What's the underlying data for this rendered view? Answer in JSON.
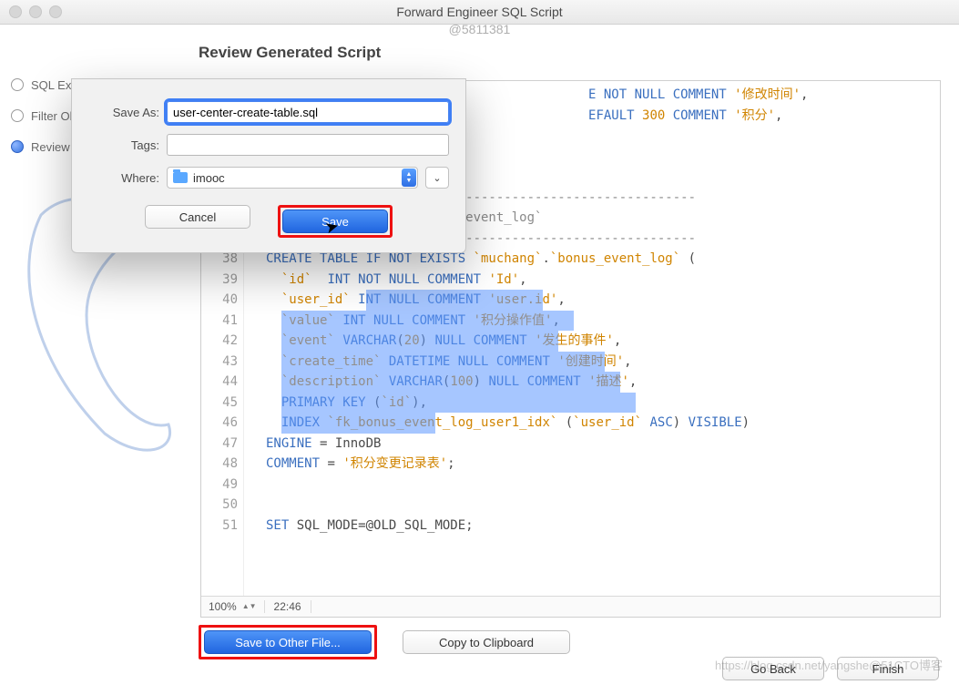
{
  "window": {
    "title": "Forward Engineer SQL Script",
    "top_watermark": "@5811381",
    "bottom_watermark": "https://blog.csdn.net/yangshe@51CTO博客"
  },
  "heading": "Review Generated Script",
  "steps": [
    {
      "label": "SQL Export Options"
    },
    {
      "label": "Filter Objects"
    },
    {
      "label": "Review Script"
    }
  ],
  "active_step_index": 2,
  "dialog": {
    "saveas_label": "Save As:",
    "tags_label": "Tags:",
    "where_label": "Where:",
    "filename": "user-center-create-table.sql",
    "tags": "",
    "where_folder": "imooc",
    "cancel": "Cancel",
    "save": "Save"
  },
  "editor": {
    "zoom": "100%",
    "position": "22:46",
    "first_line_no": 30,
    "fold": {
      "open_at": 39,
      "close_at": 46
    },
    "lines": [
      [
        [
          "plain",
          "                                          "
        ],
        [
          "kw",
          "E NOT NULL COMMENT "
        ],
        [
          "str",
          "'修改时间'"
        ],
        [
          "default",
          ","
        ]
      ],
      [
        [
          "plain",
          "                                          "
        ],
        [
          "kw",
          "EFAULT "
        ],
        [
          "num",
          "300"
        ],
        [
          "kw",
          " COMMENT "
        ],
        [
          "str",
          "'积分'"
        ],
        [
          "default",
          ","
        ]
      ],
      [],
      [],
      [],
      [
        [
          "cmt",
          "-- -----------------------------------------------------"
        ]
      ],
      [
        [
          "cmt",
          "-- Table `muchang`.`bonus_event_log`"
        ]
      ],
      [
        [
          "cmt",
          "-- -----------------------------------------------------"
        ]
      ],
      [
        [
          "kw",
          "CREATE TABLE IF NOT EXISTS "
        ],
        [
          "ident",
          "`muchang`"
        ],
        [
          "default",
          "."
        ],
        [
          "ident",
          "`bonus_event_log`"
        ],
        [
          "default",
          " ("
        ]
      ],
      [
        [
          "default",
          "  "
        ],
        [
          "ident",
          "`id`"
        ],
        [
          "default",
          "  "
        ],
        [
          "kw",
          "INT "
        ],
        [
          "kw",
          "NOT NULL COMMENT "
        ],
        [
          "str",
          "'Id'"
        ],
        [
          "default",
          ","
        ]
      ],
      [
        [
          "default",
          "  "
        ],
        [
          "ident",
          "`user_id`"
        ],
        [
          "default",
          " "
        ],
        [
          "kw",
          "INT NULL COMMENT "
        ],
        [
          "str",
          "'user.id'"
        ],
        [
          "default",
          ","
        ]
      ],
      [
        [
          "default",
          "  "
        ],
        [
          "ident",
          "`value`"
        ],
        [
          "default",
          " "
        ],
        [
          "kw",
          "INT NULL COMMENT "
        ],
        [
          "str",
          "'积分操作值'"
        ],
        [
          "default",
          ","
        ]
      ],
      [
        [
          "default",
          "  "
        ],
        [
          "ident",
          "`event`"
        ],
        [
          "default",
          " "
        ],
        [
          "kw",
          "VARCHAR"
        ],
        [
          "default",
          "("
        ],
        [
          "num",
          "20"
        ],
        [
          "default",
          ") "
        ],
        [
          "kw",
          "NULL COMMENT "
        ],
        [
          "str",
          "'发生的事件'"
        ],
        [
          "default",
          ","
        ]
      ],
      [
        [
          "default",
          "  "
        ],
        [
          "ident",
          "`create_time`"
        ],
        [
          "default",
          " "
        ],
        [
          "kw",
          "DATETIME NULL COMMENT "
        ],
        [
          "str",
          "'创建时间'"
        ],
        [
          "default",
          ","
        ]
      ],
      [
        [
          "default",
          "  "
        ],
        [
          "ident",
          "`description`"
        ],
        [
          "default",
          " "
        ],
        [
          "kw",
          "VARCHAR"
        ],
        [
          "default",
          "("
        ],
        [
          "num",
          "100"
        ],
        [
          "default",
          ") "
        ],
        [
          "kw",
          "NULL COMMENT "
        ],
        [
          "str",
          "'描述'"
        ],
        [
          "default",
          ","
        ]
      ],
      [
        [
          "default",
          "  "
        ],
        [
          "kw",
          "PRIMARY KEY "
        ],
        [
          "default",
          "("
        ],
        [
          "ident",
          "`id`"
        ],
        [
          "default",
          "),"
        ]
      ],
      [
        [
          "default",
          "  "
        ],
        [
          "kw",
          "INDEX "
        ],
        [
          "ident",
          "`fk_bonus_event_log_user1_idx`"
        ],
        [
          "default",
          " ("
        ],
        [
          "ident",
          "`user_id`"
        ],
        [
          "default",
          " "
        ],
        [
          "kw",
          "ASC"
        ],
        [
          "default",
          ") "
        ],
        [
          "kw",
          "VISIBLE"
        ],
        [
          "default",
          ")"
        ]
      ],
      [
        [
          "kw",
          "ENGINE"
        ],
        [
          "default",
          " = InnoDB"
        ]
      ],
      [
        [
          "kw",
          "COMMENT"
        ],
        [
          "default",
          " = "
        ],
        [
          "str",
          "'积分变更记录表'"
        ],
        [
          "default",
          ";"
        ]
      ],
      [],
      [],
      [
        [
          "kw",
          "SET"
        ],
        [
          "default",
          " SQL_MODE=@OLD_SQL_MODE;"
        ]
      ]
    ],
    "highlights": [
      {
        "row": 10,
        "ch_from": 13,
        "ch_to": 36
      },
      {
        "row": 11,
        "ch_from": 2,
        "ch_to": 40
      },
      {
        "row": 12,
        "ch_from": 2,
        "ch_to": 38
      },
      {
        "row": 13,
        "ch_from": 2,
        "ch_to": 44
      },
      {
        "row": 14,
        "ch_from": 2,
        "ch_to": 46
      },
      {
        "row": 15,
        "ch_from": 2,
        "ch_to": 48
      },
      {
        "row": 16,
        "ch_from": 2,
        "ch_to": 22
      }
    ]
  },
  "buttons": {
    "save_to_file": "Save to Other File...",
    "copy": "Copy to Clipboard",
    "go_back": "Go Back",
    "finish": "Finish"
  }
}
